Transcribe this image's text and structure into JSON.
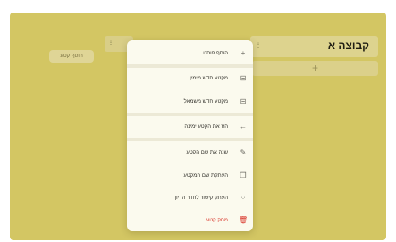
{
  "board": {
    "group_title": "קבוצה א",
    "add_row_icon": "+",
    "add_section_label": "הוסף קטע"
  },
  "menu": {
    "items": [
      {
        "label": "הוסף פוסט",
        "icon": "plus-icon",
        "glyph": "+"
      },
      {
        "label": "מקטע חדש מימין",
        "icon": "section-insert-icon",
        "glyph": "⊟"
      },
      {
        "label": "מקטע חדש משמאל",
        "icon": "section-insert-icon",
        "glyph": "⊟"
      },
      {
        "label": "הזז את הקטע ימינה",
        "icon": "arrow-left-icon",
        "glyph": "←"
      },
      {
        "label": "שנה את שם הקטע",
        "icon": "pencil-icon",
        "glyph": "✎"
      },
      {
        "label": "העתקת שם המקטע",
        "icon": "copy-icon",
        "glyph": "❐"
      },
      {
        "label": "העתק קישור לחדר הדיון",
        "icon": "link-grid-icon",
        "glyph": "⁘"
      },
      {
        "label": "מחק קטע",
        "icon": "trash-icon",
        "glyph": "🗑"
      }
    ]
  }
}
